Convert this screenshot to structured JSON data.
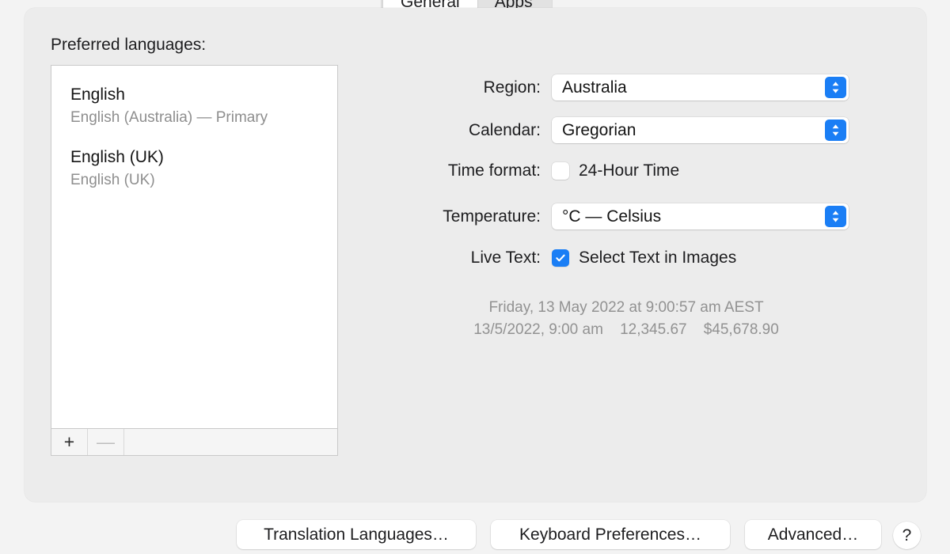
{
  "tabs": [
    {
      "label": "General",
      "selected": true
    },
    {
      "label": "Apps",
      "selected": false
    }
  ],
  "left": {
    "preferred_languages_label": "Preferred languages:",
    "languages": [
      {
        "title": "English",
        "subtitle": "English (Australia) — Primary"
      },
      {
        "title": "English (UK)",
        "subtitle": "English (UK)"
      }
    ],
    "toolbar": {
      "add_label": "+",
      "remove_label": "—"
    }
  },
  "form": {
    "region": {
      "label": "Region:",
      "value": "Australia"
    },
    "calendar": {
      "label": "Calendar:",
      "value": "Gregorian"
    },
    "time_format": {
      "label": "Time format:",
      "checkbox_label": "24-Hour Time",
      "checked": false
    },
    "temperature": {
      "label": "Temperature:",
      "value": "°C — Celsius"
    },
    "live_text": {
      "label": "Live Text:",
      "checkbox_label": "Select Text in Images",
      "checked": true
    }
  },
  "samples": {
    "line1": "Friday, 13 May 2022 at 9:00:57 am AEST",
    "date": "13/5/2022, 9:00 am",
    "number": "12,345.67",
    "currency": "$45,678.90"
  },
  "buttons": {
    "translation": "Translation Languages…",
    "keyboard": "Keyboard Preferences…",
    "advanced": "Advanced…",
    "help": "?"
  },
  "colors": {
    "accent": "#1a7ef5",
    "panel_bg": "#ececec",
    "window_bg": "#f3f3f3"
  }
}
